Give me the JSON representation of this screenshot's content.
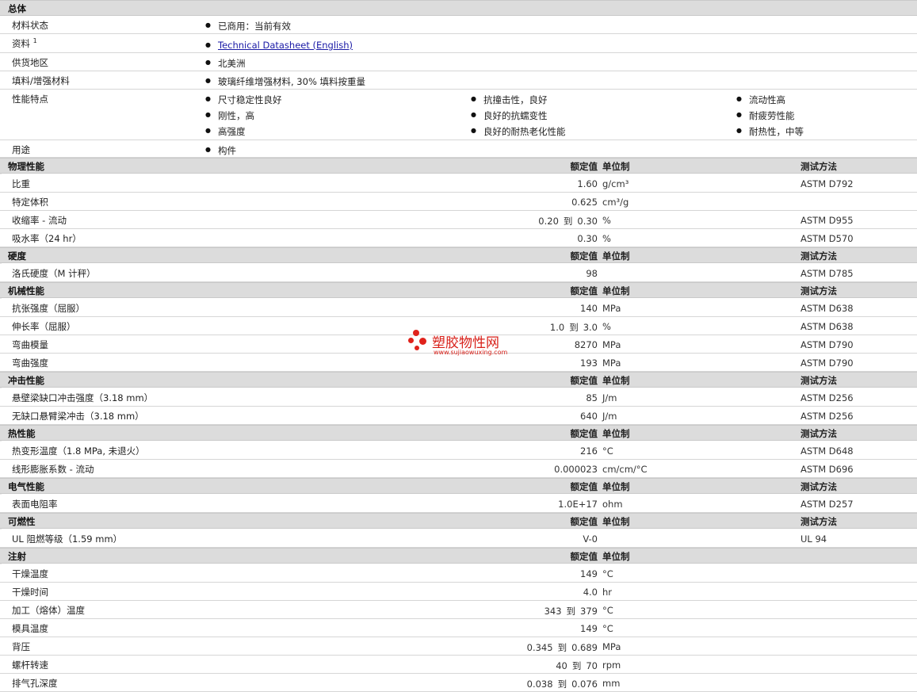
{
  "general": {
    "title": "总体",
    "rows": [
      {
        "label": "材料状态",
        "items": [
          "已商用：当前有效"
        ]
      },
      {
        "label": "资料",
        "sup": "1",
        "items": [
          "Technical Datasheet (English)"
        ]
      },
      {
        "label": "供货地区",
        "items": [
          "北美洲"
        ]
      },
      {
        "label": "填料/增强材料",
        "items": [
          "玻璃纤维增强材料, 30% 填料按重量"
        ]
      },
      {
        "label": "性能特点",
        "items": [
          "尺寸稳定性良好",
          "抗撞击性，良好",
          "流动性高",
          "刚性，高",
          "良好的抗蠕变性",
          "耐疲劳性能",
          "高强度",
          "良好的耐热老化性能",
          "耐热性，中等"
        ]
      },
      {
        "label": "用途",
        "items": [
          "构件"
        ]
      }
    ]
  },
  "headers": {
    "nominal": "额定值",
    "unit": "单位制",
    "method": "测试方法"
  },
  "sections": [
    {
      "title": "物理性能",
      "rows": [
        {
          "label": "比重",
          "value": "1.60",
          "unit": "g/cm³",
          "method": "ASTM D792"
        },
        {
          "label": "特定体积",
          "value": "0.625",
          "unit": "cm³/g",
          "method": ""
        },
        {
          "label": "收缩率 - 流动",
          "v1": "0.20",
          "sep": "到",
          "v2": "0.30",
          "unit": "%",
          "method": "ASTM D955"
        },
        {
          "label": "吸水率（24 hr）",
          "value": "0.30",
          "unit": "%",
          "method": "ASTM D570"
        }
      ]
    },
    {
      "title": "硬度",
      "rows": [
        {
          "label": "洛氏硬度（M 计秤）",
          "value": "98",
          "unit": "",
          "method": "ASTM D785"
        }
      ]
    },
    {
      "title": "机械性能",
      "rows": [
        {
          "label": "抗张强度（屈服）",
          "value": "140",
          "unit": "MPa",
          "method": "ASTM D638"
        },
        {
          "label": "伸长率（屈服）",
          "v1": "1.0",
          "sep": "到",
          "v2": "3.0",
          "unit": "%",
          "method": "ASTM D638"
        },
        {
          "label": "弯曲模量",
          "value": "8270",
          "unit": "MPa",
          "method": "ASTM D790"
        },
        {
          "label": "弯曲强度",
          "value": "193",
          "unit": "MPa",
          "method": "ASTM D790"
        }
      ]
    },
    {
      "title": "冲击性能",
      "rows": [
        {
          "label": "悬壁梁缺口冲击强度（3.18 mm）",
          "value": "85",
          "unit": "J/m",
          "method": "ASTM D256"
        },
        {
          "label": "无缺口悬臂梁冲击（3.18 mm）",
          "value": "640",
          "unit": "J/m",
          "method": "ASTM D256"
        }
      ]
    },
    {
      "title": "热性能",
      "rows": [
        {
          "label": "热变形温度（1.8 MPa, 未退火）",
          "value": "216",
          "unit": "°C",
          "method": "ASTM D648"
        },
        {
          "label": "线形膨胀系数 - 流动",
          "value": "0.000023",
          "unit": "cm/cm/°C",
          "method": "ASTM D696"
        }
      ]
    },
    {
      "title": "电气性能",
      "rows": [
        {
          "label": "表面电阻率",
          "value": "1.0E+17",
          "unit": "ohm",
          "method": "ASTM D257"
        }
      ]
    },
    {
      "title": "可燃性",
      "rows": [
        {
          "label": "UL 阻燃等级（1.59 mm）",
          "value": "V-0",
          "unit": "",
          "method": "UL 94"
        }
      ]
    },
    {
      "title": "注射",
      "noMethod": true,
      "rows": [
        {
          "label": "干燥温度",
          "value": "149",
          "unit": "°C",
          "method": ""
        },
        {
          "label": "干燥时间",
          "value": "4.0",
          "unit": "hr",
          "method": ""
        },
        {
          "label": "加工（熔体）温度",
          "v1": "343",
          "sep": "到",
          "v2": "379",
          "unit": "°C",
          "method": ""
        },
        {
          "label": "模具温度",
          "value": "149",
          "unit": "°C",
          "method": ""
        },
        {
          "label": "背压",
          "v1": "0.345",
          "sep": "到",
          "v2": "0.689",
          "unit": "MPa",
          "method": ""
        },
        {
          "label": "螺杆转速",
          "v1": "40",
          "sep": "到",
          "v2": "70",
          "unit": "rpm",
          "method": ""
        },
        {
          "label": "排气孔深度",
          "v1": "0.038",
          "sep": "到",
          "v2": "0.076",
          "unit": "mm",
          "method": ""
        }
      ]
    }
  ],
  "watermark": {
    "cn": "塑胶物性网",
    "en": "www.sujiaowuxing.com",
    "color": "#d8211a"
  }
}
